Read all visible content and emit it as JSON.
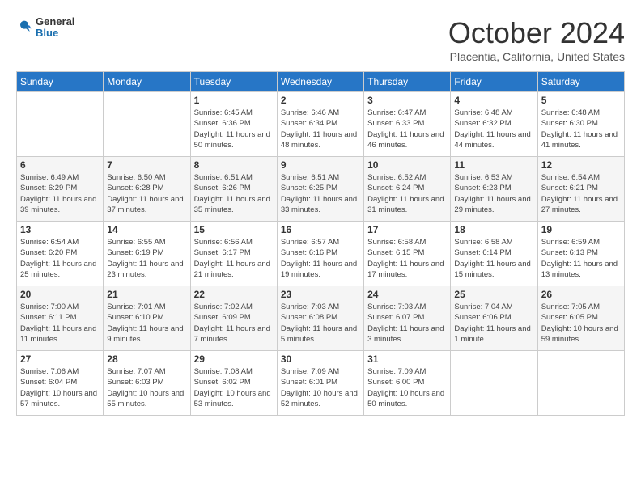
{
  "logo": {
    "text_general": "General",
    "text_blue": "Blue"
  },
  "header": {
    "month": "October 2024",
    "location": "Placentia, California, United States"
  },
  "weekdays": [
    "Sunday",
    "Monday",
    "Tuesday",
    "Wednesday",
    "Thursday",
    "Friday",
    "Saturday"
  ],
  "weeks": [
    [
      {
        "day": "",
        "info": ""
      },
      {
        "day": "",
        "info": ""
      },
      {
        "day": "1",
        "info": "Sunrise: 6:45 AM\nSunset: 6:36 PM\nDaylight: 11 hours and 50 minutes."
      },
      {
        "day": "2",
        "info": "Sunrise: 6:46 AM\nSunset: 6:34 PM\nDaylight: 11 hours and 48 minutes."
      },
      {
        "day": "3",
        "info": "Sunrise: 6:47 AM\nSunset: 6:33 PM\nDaylight: 11 hours and 46 minutes."
      },
      {
        "day": "4",
        "info": "Sunrise: 6:48 AM\nSunset: 6:32 PM\nDaylight: 11 hours and 44 minutes."
      },
      {
        "day": "5",
        "info": "Sunrise: 6:48 AM\nSunset: 6:30 PM\nDaylight: 11 hours and 41 minutes."
      }
    ],
    [
      {
        "day": "6",
        "info": "Sunrise: 6:49 AM\nSunset: 6:29 PM\nDaylight: 11 hours and 39 minutes."
      },
      {
        "day": "7",
        "info": "Sunrise: 6:50 AM\nSunset: 6:28 PM\nDaylight: 11 hours and 37 minutes."
      },
      {
        "day": "8",
        "info": "Sunrise: 6:51 AM\nSunset: 6:26 PM\nDaylight: 11 hours and 35 minutes."
      },
      {
        "day": "9",
        "info": "Sunrise: 6:51 AM\nSunset: 6:25 PM\nDaylight: 11 hours and 33 minutes."
      },
      {
        "day": "10",
        "info": "Sunrise: 6:52 AM\nSunset: 6:24 PM\nDaylight: 11 hours and 31 minutes."
      },
      {
        "day": "11",
        "info": "Sunrise: 6:53 AM\nSunset: 6:23 PM\nDaylight: 11 hours and 29 minutes."
      },
      {
        "day": "12",
        "info": "Sunrise: 6:54 AM\nSunset: 6:21 PM\nDaylight: 11 hours and 27 minutes."
      }
    ],
    [
      {
        "day": "13",
        "info": "Sunrise: 6:54 AM\nSunset: 6:20 PM\nDaylight: 11 hours and 25 minutes."
      },
      {
        "day": "14",
        "info": "Sunrise: 6:55 AM\nSunset: 6:19 PM\nDaylight: 11 hours and 23 minutes."
      },
      {
        "day": "15",
        "info": "Sunrise: 6:56 AM\nSunset: 6:17 PM\nDaylight: 11 hours and 21 minutes."
      },
      {
        "day": "16",
        "info": "Sunrise: 6:57 AM\nSunset: 6:16 PM\nDaylight: 11 hours and 19 minutes."
      },
      {
        "day": "17",
        "info": "Sunrise: 6:58 AM\nSunset: 6:15 PM\nDaylight: 11 hours and 17 minutes."
      },
      {
        "day": "18",
        "info": "Sunrise: 6:58 AM\nSunset: 6:14 PM\nDaylight: 11 hours and 15 minutes."
      },
      {
        "day": "19",
        "info": "Sunrise: 6:59 AM\nSunset: 6:13 PM\nDaylight: 11 hours and 13 minutes."
      }
    ],
    [
      {
        "day": "20",
        "info": "Sunrise: 7:00 AM\nSunset: 6:11 PM\nDaylight: 11 hours and 11 minutes."
      },
      {
        "day": "21",
        "info": "Sunrise: 7:01 AM\nSunset: 6:10 PM\nDaylight: 11 hours and 9 minutes."
      },
      {
        "day": "22",
        "info": "Sunrise: 7:02 AM\nSunset: 6:09 PM\nDaylight: 11 hours and 7 minutes."
      },
      {
        "day": "23",
        "info": "Sunrise: 7:03 AM\nSunset: 6:08 PM\nDaylight: 11 hours and 5 minutes."
      },
      {
        "day": "24",
        "info": "Sunrise: 7:03 AM\nSunset: 6:07 PM\nDaylight: 11 hours and 3 minutes."
      },
      {
        "day": "25",
        "info": "Sunrise: 7:04 AM\nSunset: 6:06 PM\nDaylight: 11 hours and 1 minute."
      },
      {
        "day": "26",
        "info": "Sunrise: 7:05 AM\nSunset: 6:05 PM\nDaylight: 10 hours and 59 minutes."
      }
    ],
    [
      {
        "day": "27",
        "info": "Sunrise: 7:06 AM\nSunset: 6:04 PM\nDaylight: 10 hours and 57 minutes."
      },
      {
        "day": "28",
        "info": "Sunrise: 7:07 AM\nSunset: 6:03 PM\nDaylight: 10 hours and 55 minutes."
      },
      {
        "day": "29",
        "info": "Sunrise: 7:08 AM\nSunset: 6:02 PM\nDaylight: 10 hours and 53 minutes."
      },
      {
        "day": "30",
        "info": "Sunrise: 7:09 AM\nSunset: 6:01 PM\nDaylight: 10 hours and 52 minutes."
      },
      {
        "day": "31",
        "info": "Sunrise: 7:09 AM\nSunset: 6:00 PM\nDaylight: 10 hours and 50 minutes."
      },
      {
        "day": "",
        "info": ""
      },
      {
        "day": "",
        "info": ""
      }
    ]
  ]
}
